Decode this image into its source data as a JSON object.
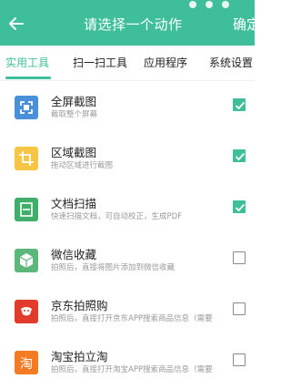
{
  "header": {
    "title": "请选择一个动作",
    "confirm_label": "确定",
    "background": "#3fbe9b"
  },
  "tabs": [
    {
      "label": "实用工具",
      "active": true
    },
    {
      "label": "扫一扫工具",
      "active": false
    },
    {
      "label": "应用程序",
      "active": false
    },
    {
      "label": "系统设置",
      "active": false
    }
  ],
  "actions": [
    {
      "title": "全屏截图",
      "desc": "截取整个屏幕",
      "icon": "fullscreen-screenshot-icon",
      "color": "#4a90d9",
      "checked": true
    },
    {
      "title": "区域截图",
      "desc": "拖动区域进行截图",
      "icon": "region-screenshot-icon",
      "color": "#f5c543",
      "checked": true
    },
    {
      "title": "文档扫描",
      "desc": "快速扫描文档，可自动校正，生成PDF",
      "icon": "document-scan-icon",
      "color": "#3fae6a",
      "checked": true
    },
    {
      "title": "微信收藏",
      "desc": "拍照后，直接将图片添加到微信收藏",
      "icon": "wechat-favorite-icon",
      "color": "#5cb87a",
      "checked": false
    },
    {
      "title": "京东拍照购",
      "desc": "拍照后，直接打开京东APP搜索商品信息（需要…",
      "icon": "jd-photo-shop-icon",
      "color": "#e23a2b",
      "checked": false
    },
    {
      "title": "淘宝拍立淘",
      "desc": "拍照后，直接打开淘宝APP搜索商品信息（需要…",
      "icon": "taobao-photo-search-icon",
      "color": "#f57a22",
      "checked": false,
      "glyph": "淘"
    }
  ]
}
